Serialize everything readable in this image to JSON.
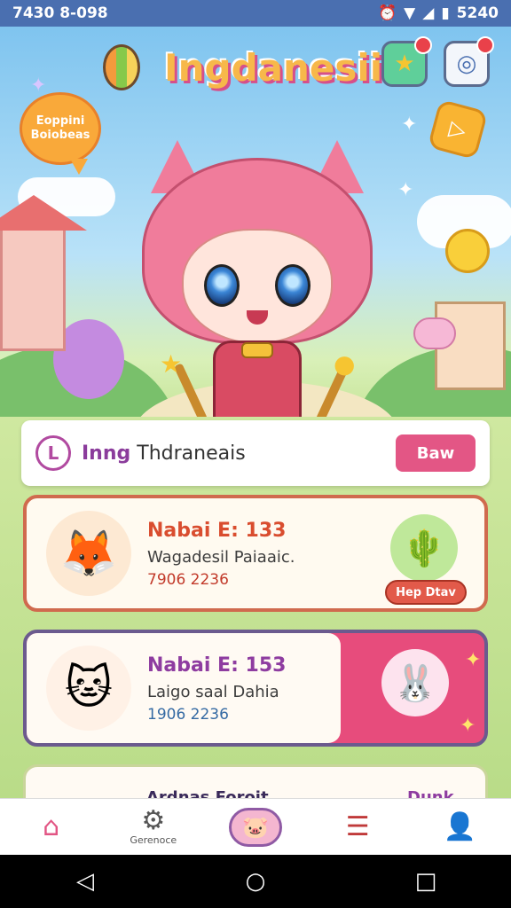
{
  "status_bar": {
    "time": "7430 8-098",
    "battery": "5240"
  },
  "header": {
    "app_title": "Ingdanesii"
  },
  "promo_bubble": {
    "line1": "Eoppini",
    "line2": "Boiobeas"
  },
  "search": {
    "logo_letter": "L",
    "text_part1": "Inng",
    "text_part2": "Thdraneais",
    "button_label": "Baw"
  },
  "cards": [
    {
      "title": "Nabai E: 133",
      "subtitle": "Wagadesil Paiaaic.",
      "meta": "7906 2236",
      "button_label": "Hep Dtav",
      "title_color": "#d94d2f",
      "meta_color": "#c23a2a"
    },
    {
      "title": "Nabai E: 153",
      "subtitle": "Laigo saal Dahia",
      "meta": "1906 2236",
      "title_color": "#8e3ca0",
      "meta_color": "#356aa3"
    },
    {
      "title": "Ardnas Foroit",
      "badge": "Dunk"
    }
  ],
  "bottom_nav": {
    "items": [
      {
        "icon": "home-icon",
        "label": ""
      },
      {
        "icon": "gear-icon",
        "label": "Gerenoce"
      },
      {
        "icon": "mascot-icon",
        "label": ""
      },
      {
        "icon": "list-icon",
        "label": ""
      },
      {
        "icon": "user-icon",
        "label": ""
      }
    ]
  },
  "colors": {
    "accent": "#e35685",
    "status_bar": "#4a6fb0",
    "title": "#f7b84a"
  }
}
